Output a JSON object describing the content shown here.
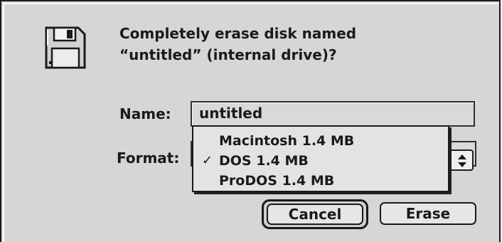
{
  "dialog": {
    "message_line1": "Completely erase disk named",
    "message_line2": "“untitled” (internal drive)?",
    "icon": "floppy-disk-icon"
  },
  "name_field": {
    "label": "Name:",
    "value": "untitled"
  },
  "format": {
    "label": "Format:",
    "selected": "DOS 1.4 MB",
    "options": [
      {
        "label": "Macintosh 1.4 MB",
        "checked": false
      },
      {
        "label": "DOS 1.4 MB",
        "checked": true
      },
      {
        "label": "ProDOS 1.4 MB",
        "checked": false
      }
    ],
    "check_mark": "✓",
    "arrows_icon": "updown-arrows-icon"
  },
  "buttons": {
    "cancel": "Cancel",
    "erase": "Erase"
  },
  "colors": {
    "dialog_background": "#d6d6d6",
    "menu_background": "#e3e3e3",
    "text": "#1a1a1a"
  }
}
